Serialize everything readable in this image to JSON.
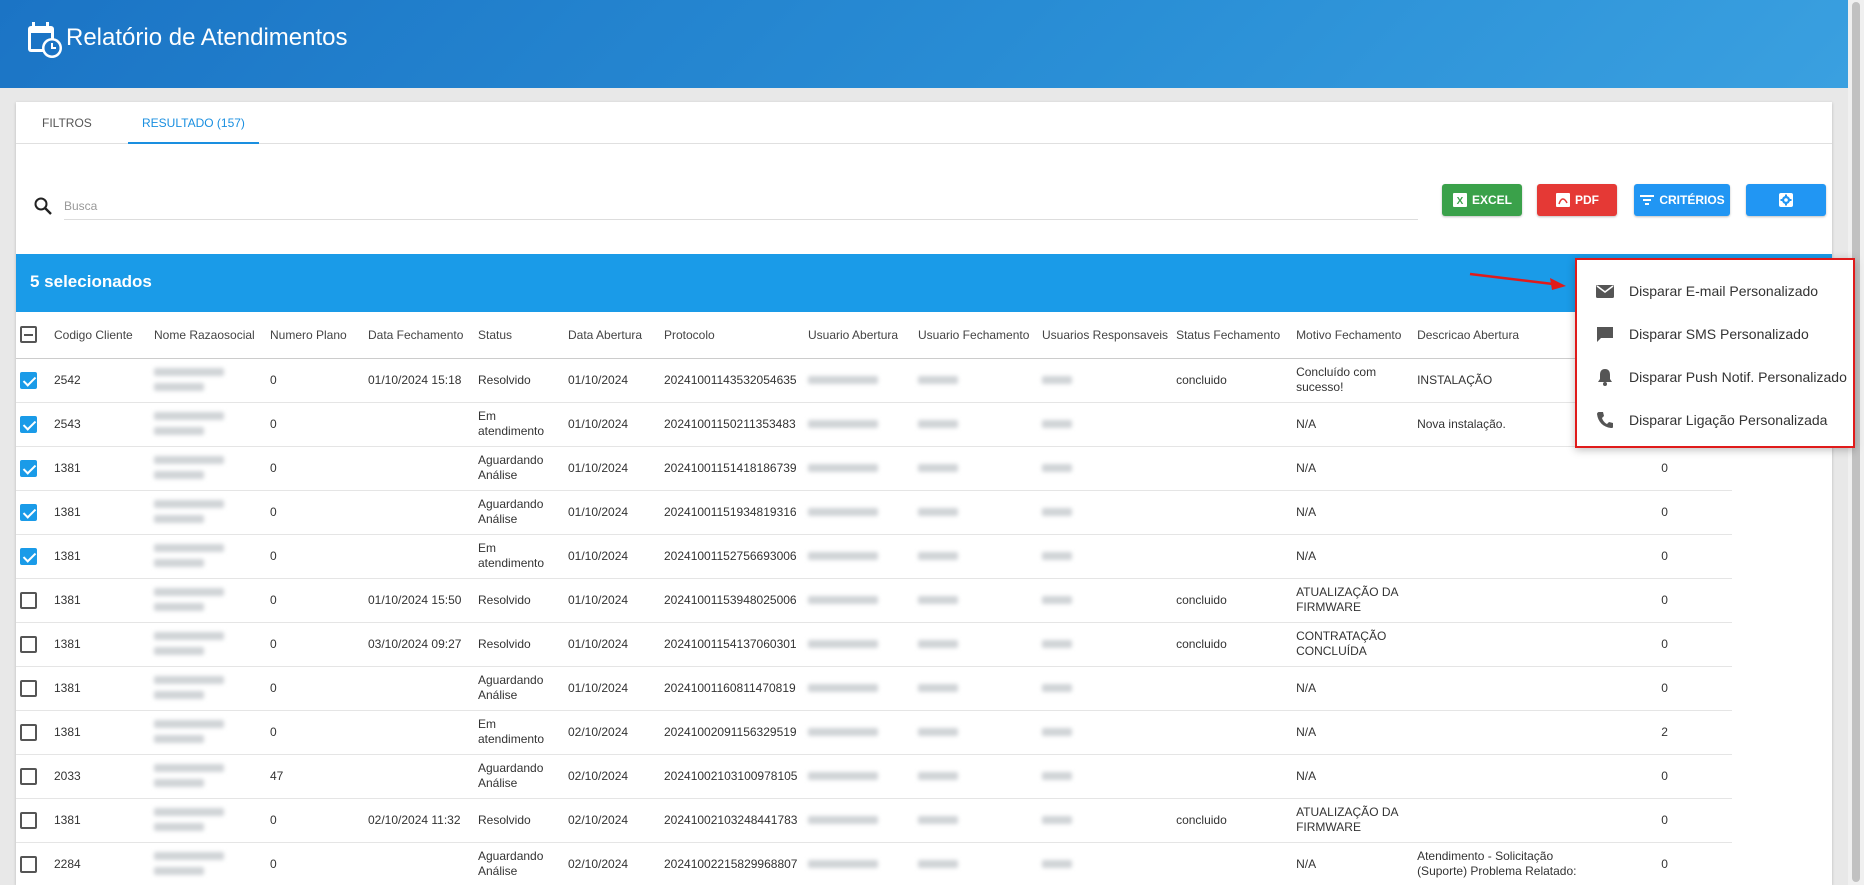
{
  "header": {
    "title": "Relatório de Atendimentos"
  },
  "tabs": [
    {
      "label": "FILTROS"
    },
    {
      "label": "RESULTADO (157)"
    }
  ],
  "search": {
    "placeholder": "Busca",
    "value": ""
  },
  "toolbar": {
    "excel_label": "EXCEL",
    "pdf_label": "PDF",
    "criterios_label": "CRITÉRIOS",
    "settings_icon": "gear-icon"
  },
  "selection": {
    "label": "5 selecionados"
  },
  "table": {
    "columns": [
      "Codigo Cliente",
      "Nome Razaosocial",
      "Numero Plano",
      "Data Fechamento",
      "Status",
      "Data Abertura",
      "Protocolo",
      "Usuario Abertura",
      "Usuario Fechamento",
      "Usuarios Responsaveis",
      "Status Fechamento",
      "Motivo Fechamento",
      "Descricao Abertura"
    ],
    "rows": [
      {
        "checked": true,
        "codigo": "2542",
        "plano": "0",
        "fechamento": "01/10/2024 15:18",
        "status": "Resolvido",
        "abertura": "01/10/2024",
        "protocolo": "20241001143532054635",
        "status_fech": "concluido",
        "motivo": "Concluído com sucesso!",
        "descricao": "INSTALAÇÃO",
        "extra": ""
      },
      {
        "checked": true,
        "codigo": "2543",
        "plano": "0",
        "fechamento": "",
        "status": "Em atendimento",
        "abertura": "01/10/2024",
        "protocolo": "20241001150211353483",
        "status_fech": "",
        "motivo": "N/A",
        "descricao": "Nova instalação.",
        "extra": ""
      },
      {
        "checked": true,
        "codigo": "1381",
        "plano": "0",
        "fechamento": "",
        "status": "Aguardando Análise",
        "abertura": "01/10/2024",
        "protocolo": "20241001151418186739",
        "status_fech": "",
        "motivo": "N/A",
        "descricao": "",
        "extra": "0"
      },
      {
        "checked": true,
        "codigo": "1381",
        "plano": "0",
        "fechamento": "",
        "status": "Aguardando Análise",
        "abertura": "01/10/2024",
        "protocolo": "20241001151934819316",
        "status_fech": "",
        "motivo": "N/A",
        "descricao": "",
        "extra": "0"
      },
      {
        "checked": true,
        "codigo": "1381",
        "plano": "0",
        "fechamento": "",
        "status": "Em atendimento",
        "abertura": "01/10/2024",
        "protocolo": "20241001152756693006",
        "status_fech": "",
        "motivo": "N/A",
        "descricao": "",
        "extra": "0"
      },
      {
        "checked": false,
        "codigo": "1381",
        "plano": "0",
        "fechamento": "01/10/2024 15:50",
        "status": "Resolvido",
        "abertura": "01/10/2024",
        "protocolo": "20241001153948025006",
        "status_fech": "concluido",
        "motivo": "ATUALIZAÇÃO DA FIRMWARE",
        "descricao": "",
        "extra": "0"
      },
      {
        "checked": false,
        "codigo": "1381",
        "plano": "0",
        "fechamento": "03/10/2024 09:27",
        "status": "Resolvido",
        "abertura": "01/10/2024",
        "protocolo": "20241001154137060301",
        "status_fech": "concluido",
        "motivo": "CONTRATAÇÃO CONCLUÍDA",
        "descricao": "",
        "extra": "0"
      },
      {
        "checked": false,
        "codigo": "1381",
        "plano": "0",
        "fechamento": "",
        "status": "Aguardando Análise",
        "abertura": "01/10/2024",
        "protocolo": "20241001160811470819",
        "status_fech": "",
        "motivo": "N/A",
        "descricao": "",
        "extra": "0"
      },
      {
        "checked": false,
        "codigo": "1381",
        "plano": "0",
        "fechamento": "",
        "status": "Em atendimento",
        "abertura": "02/10/2024",
        "protocolo": "20241002091156329519",
        "status_fech": "",
        "motivo": "N/A",
        "descricao": "",
        "extra": "2"
      },
      {
        "checked": false,
        "codigo": "2033",
        "plano": "47",
        "fechamento": "",
        "status": "Aguardando Análise",
        "abertura": "02/10/2024",
        "protocolo": "20241002103100978105",
        "status_fech": "",
        "motivo": "N/A",
        "descricao": "",
        "extra": "0"
      },
      {
        "checked": false,
        "codigo": "1381",
        "plano": "0",
        "fechamento": "02/10/2024 11:32",
        "status": "Resolvido",
        "abertura": "02/10/2024",
        "protocolo": "20241002103248441783",
        "status_fech": "concluido",
        "motivo": "ATUALIZAÇÃO DA FIRMWARE",
        "descricao": "",
        "extra": "0"
      },
      {
        "checked": false,
        "codigo": "2284",
        "plano": "0",
        "fechamento": "",
        "status": "Aguardando Análise",
        "abertura": "02/10/2024",
        "protocolo": "20241002215829968807",
        "status_fech": "",
        "motivo": "N/A",
        "descricao": "Atendimento - Solicitação (Suporte) Problema Relatado:",
        "extra": "0"
      }
    ]
  },
  "menu": {
    "items": [
      {
        "label": "Disparar E-mail Personalizado",
        "icon": "mail-icon"
      },
      {
        "label": "Disparar SMS Personalizado",
        "icon": "chat-icon"
      },
      {
        "label": "Disparar Push Notif. Personalizado",
        "icon": "bell-icon"
      },
      {
        "label": "Disparar Ligação Personalizada",
        "icon": "phone-icon"
      }
    ]
  }
}
